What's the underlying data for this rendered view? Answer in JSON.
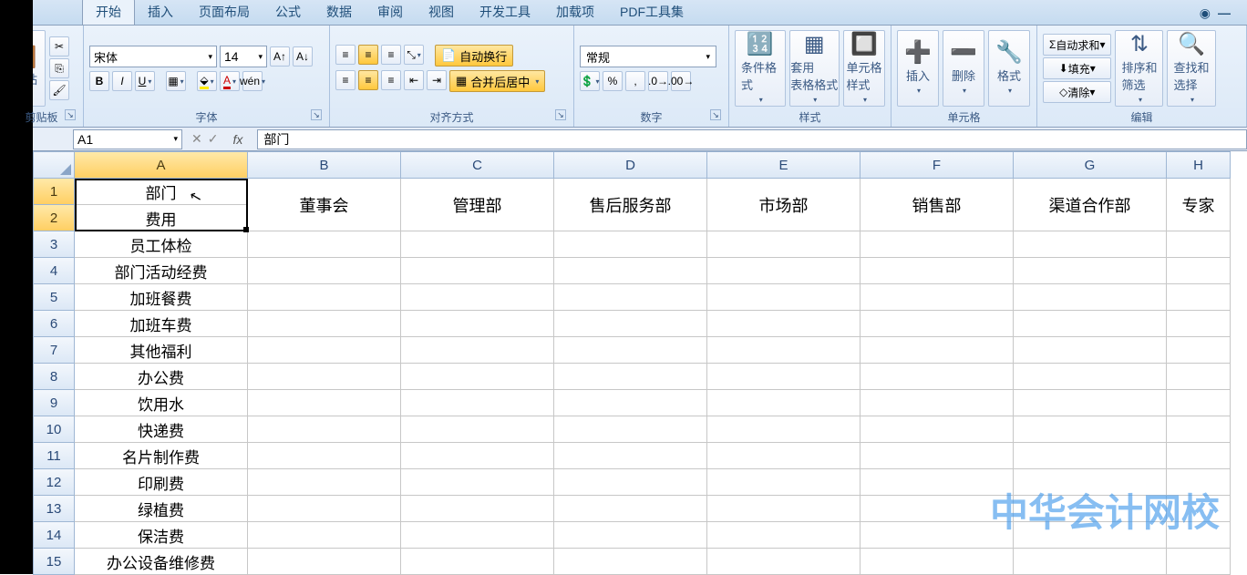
{
  "tabs": [
    "开始",
    "插入",
    "页面布局",
    "公式",
    "数据",
    "审阅",
    "视图",
    "开发工具",
    "加载项",
    "PDF工具集"
  ],
  "active_tab": 0,
  "groups": {
    "clipboard": {
      "label": "剪贴板",
      "paste": "粘贴"
    },
    "font": {
      "label": "字体",
      "name": "宋体",
      "size": "14",
      "bold": "B",
      "italic": "I",
      "underline": "U"
    },
    "align": {
      "label": "对齐方式",
      "wrap": "自动换行",
      "merge": "合并后居中"
    },
    "number": {
      "label": "数字",
      "format": "常规"
    },
    "styles": {
      "label": "样式",
      "cond": "条件格式",
      "table": "套用\n表格格式",
      "cell": "单元格\n样式"
    },
    "cells": {
      "label": "单元格",
      "insert": "插入",
      "delete": "删除",
      "format": "格式"
    },
    "editing": {
      "label": "编辑",
      "sum": "自动求和",
      "fill": "填充",
      "clear": "清除",
      "sort": "排序和\n筛选",
      "find": "查找和\n选择"
    }
  },
  "namebox": "A1",
  "formula": "部门",
  "columns": [
    {
      "letter": "A",
      "w": 190,
      "sel": true
    },
    {
      "letter": "B",
      "w": 168
    },
    {
      "letter": "C",
      "w": 168
    },
    {
      "letter": "D",
      "w": 168
    },
    {
      "letter": "E",
      "w": 168
    },
    {
      "letter": "F",
      "w": 168
    },
    {
      "letter": "G",
      "w": 168
    },
    {
      "letter": "H",
      "w": 70
    }
  ],
  "rows": [
    {
      "n": 1,
      "sel": true
    },
    {
      "n": 2,
      "sel": true
    },
    {
      "n": 3
    },
    {
      "n": 4
    },
    {
      "n": 5
    },
    {
      "n": 6
    },
    {
      "n": 7
    },
    {
      "n": 8
    },
    {
      "n": 9
    },
    {
      "n": 10
    },
    {
      "n": 11
    },
    {
      "n": 12
    },
    {
      "n": 13
    },
    {
      "n": 14
    },
    {
      "n": 15
    }
  ],
  "colA": [
    "部门",
    "费用",
    "员工体检",
    "部门活动经费",
    "加班餐费",
    "加班车费",
    "其他福利",
    "办公费",
    "饮用水",
    "快递费",
    "名片制作费",
    "印刷费",
    "绿植费",
    "保洁费",
    "办公设备维修费"
  ],
  "header_row": [
    "",
    "董事会",
    "管理部",
    "售后服务部",
    "市场部",
    "销售部",
    "渠道合作部",
    "专家"
  ],
  "watermark": "中华会计网校"
}
